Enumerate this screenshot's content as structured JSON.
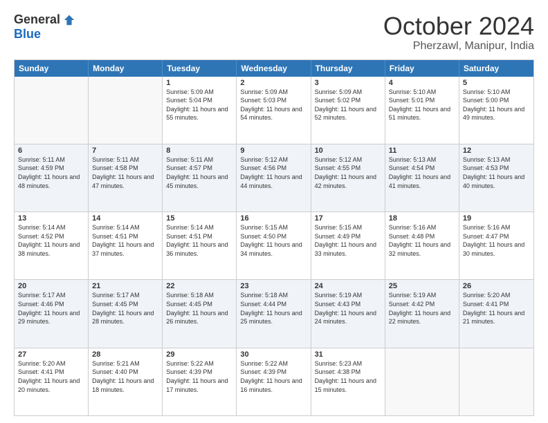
{
  "logo": {
    "general": "General",
    "blue": "Blue"
  },
  "title": {
    "month": "October 2024",
    "location": "Pherzawl, Manipur, India"
  },
  "header_days": [
    "Sunday",
    "Monday",
    "Tuesday",
    "Wednesday",
    "Thursday",
    "Friday",
    "Saturday"
  ],
  "weeks": [
    [
      {
        "day": "",
        "sunrise": "",
        "sunset": "",
        "daylight": "",
        "empty": true
      },
      {
        "day": "",
        "sunrise": "",
        "sunset": "",
        "daylight": "",
        "empty": true
      },
      {
        "day": "1",
        "sunrise": "Sunrise: 5:09 AM",
        "sunset": "Sunset: 5:04 PM",
        "daylight": "Daylight: 11 hours and 55 minutes."
      },
      {
        "day": "2",
        "sunrise": "Sunrise: 5:09 AM",
        "sunset": "Sunset: 5:03 PM",
        "daylight": "Daylight: 11 hours and 54 minutes."
      },
      {
        "day": "3",
        "sunrise": "Sunrise: 5:09 AM",
        "sunset": "Sunset: 5:02 PM",
        "daylight": "Daylight: 11 hours and 52 minutes."
      },
      {
        "day": "4",
        "sunrise": "Sunrise: 5:10 AM",
        "sunset": "Sunset: 5:01 PM",
        "daylight": "Daylight: 11 hours and 51 minutes."
      },
      {
        "day": "5",
        "sunrise": "Sunrise: 5:10 AM",
        "sunset": "Sunset: 5:00 PM",
        "daylight": "Daylight: 11 hours and 49 minutes."
      }
    ],
    [
      {
        "day": "6",
        "sunrise": "Sunrise: 5:11 AM",
        "sunset": "Sunset: 4:59 PM",
        "daylight": "Daylight: 11 hours and 48 minutes."
      },
      {
        "day": "7",
        "sunrise": "Sunrise: 5:11 AM",
        "sunset": "Sunset: 4:58 PM",
        "daylight": "Daylight: 11 hours and 47 minutes."
      },
      {
        "day": "8",
        "sunrise": "Sunrise: 5:11 AM",
        "sunset": "Sunset: 4:57 PM",
        "daylight": "Daylight: 11 hours and 45 minutes."
      },
      {
        "day": "9",
        "sunrise": "Sunrise: 5:12 AM",
        "sunset": "Sunset: 4:56 PM",
        "daylight": "Daylight: 11 hours and 44 minutes."
      },
      {
        "day": "10",
        "sunrise": "Sunrise: 5:12 AM",
        "sunset": "Sunset: 4:55 PM",
        "daylight": "Daylight: 11 hours and 42 minutes."
      },
      {
        "day": "11",
        "sunrise": "Sunrise: 5:13 AM",
        "sunset": "Sunset: 4:54 PM",
        "daylight": "Daylight: 11 hours and 41 minutes."
      },
      {
        "day": "12",
        "sunrise": "Sunrise: 5:13 AM",
        "sunset": "Sunset: 4:53 PM",
        "daylight": "Daylight: 11 hours and 40 minutes."
      }
    ],
    [
      {
        "day": "13",
        "sunrise": "Sunrise: 5:14 AM",
        "sunset": "Sunset: 4:52 PM",
        "daylight": "Daylight: 11 hours and 38 minutes."
      },
      {
        "day": "14",
        "sunrise": "Sunrise: 5:14 AM",
        "sunset": "Sunset: 4:51 PM",
        "daylight": "Daylight: 11 hours and 37 minutes."
      },
      {
        "day": "15",
        "sunrise": "Sunrise: 5:14 AM",
        "sunset": "Sunset: 4:51 PM",
        "daylight": "Daylight: 11 hours and 36 minutes."
      },
      {
        "day": "16",
        "sunrise": "Sunrise: 5:15 AM",
        "sunset": "Sunset: 4:50 PM",
        "daylight": "Daylight: 11 hours and 34 minutes."
      },
      {
        "day": "17",
        "sunrise": "Sunrise: 5:15 AM",
        "sunset": "Sunset: 4:49 PM",
        "daylight": "Daylight: 11 hours and 33 minutes."
      },
      {
        "day": "18",
        "sunrise": "Sunrise: 5:16 AM",
        "sunset": "Sunset: 4:48 PM",
        "daylight": "Daylight: 11 hours and 32 minutes."
      },
      {
        "day": "19",
        "sunrise": "Sunrise: 5:16 AM",
        "sunset": "Sunset: 4:47 PM",
        "daylight": "Daylight: 11 hours and 30 minutes."
      }
    ],
    [
      {
        "day": "20",
        "sunrise": "Sunrise: 5:17 AM",
        "sunset": "Sunset: 4:46 PM",
        "daylight": "Daylight: 11 hours and 29 minutes."
      },
      {
        "day": "21",
        "sunrise": "Sunrise: 5:17 AM",
        "sunset": "Sunset: 4:45 PM",
        "daylight": "Daylight: 11 hours and 28 minutes."
      },
      {
        "day": "22",
        "sunrise": "Sunrise: 5:18 AM",
        "sunset": "Sunset: 4:45 PM",
        "daylight": "Daylight: 11 hours and 26 minutes."
      },
      {
        "day": "23",
        "sunrise": "Sunrise: 5:18 AM",
        "sunset": "Sunset: 4:44 PM",
        "daylight": "Daylight: 11 hours and 25 minutes."
      },
      {
        "day": "24",
        "sunrise": "Sunrise: 5:19 AM",
        "sunset": "Sunset: 4:43 PM",
        "daylight": "Daylight: 11 hours and 24 minutes."
      },
      {
        "day": "25",
        "sunrise": "Sunrise: 5:19 AM",
        "sunset": "Sunset: 4:42 PM",
        "daylight": "Daylight: 11 hours and 22 minutes."
      },
      {
        "day": "26",
        "sunrise": "Sunrise: 5:20 AM",
        "sunset": "Sunset: 4:41 PM",
        "daylight": "Daylight: 11 hours and 21 minutes."
      }
    ],
    [
      {
        "day": "27",
        "sunrise": "Sunrise: 5:20 AM",
        "sunset": "Sunset: 4:41 PM",
        "daylight": "Daylight: 11 hours and 20 minutes."
      },
      {
        "day": "28",
        "sunrise": "Sunrise: 5:21 AM",
        "sunset": "Sunset: 4:40 PM",
        "daylight": "Daylight: 11 hours and 18 minutes."
      },
      {
        "day": "29",
        "sunrise": "Sunrise: 5:22 AM",
        "sunset": "Sunset: 4:39 PM",
        "daylight": "Daylight: 11 hours and 17 minutes."
      },
      {
        "day": "30",
        "sunrise": "Sunrise: 5:22 AM",
        "sunset": "Sunset: 4:39 PM",
        "daylight": "Daylight: 11 hours and 16 minutes."
      },
      {
        "day": "31",
        "sunrise": "Sunrise: 5:23 AM",
        "sunset": "Sunset: 4:38 PM",
        "daylight": "Daylight: 11 hours and 15 minutes."
      },
      {
        "day": "",
        "sunrise": "",
        "sunset": "",
        "daylight": "",
        "empty": true
      },
      {
        "day": "",
        "sunrise": "",
        "sunset": "",
        "daylight": "",
        "empty": true
      }
    ]
  ]
}
